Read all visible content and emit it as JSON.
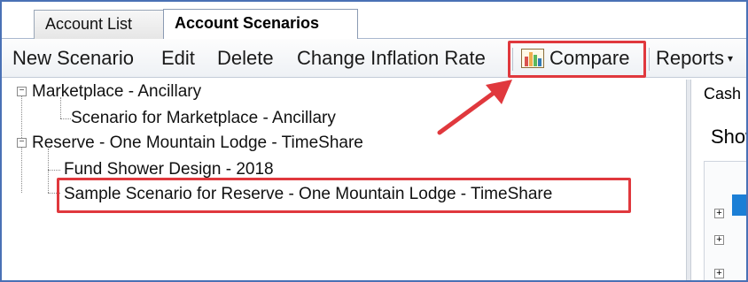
{
  "tabs": [
    {
      "label": "Account List",
      "active": false
    },
    {
      "label": "Account Scenarios",
      "active": true
    }
  ],
  "toolbar": {
    "new_scenario": "New Scenario",
    "edit": "Edit",
    "delete": "Delete",
    "change_inflation": "Change Inflation Rate",
    "compare": "Compare",
    "reports": "Reports",
    "reports_caret": "▾"
  },
  "tree": {
    "groups": [
      {
        "label": "Marketplace - Ancillary",
        "expander": "−",
        "children": [
          "Scenario for Marketplace - Ancillary"
        ]
      },
      {
        "label": "Reserve - One Mountain Lodge - TimeShare",
        "expander": "−",
        "children": [
          "Fund Shower Design - 2018",
          "Sample Scenario for Reserve - One Mountain Lodge - TimeShare"
        ]
      }
    ]
  },
  "right_panel": {
    "cash_label": "Cash",
    "show_label": "Show",
    "expander": "+"
  },
  "colors": {
    "highlight": "#e0383d",
    "frame": "#4a71b5",
    "selection": "#1b7fd6"
  }
}
